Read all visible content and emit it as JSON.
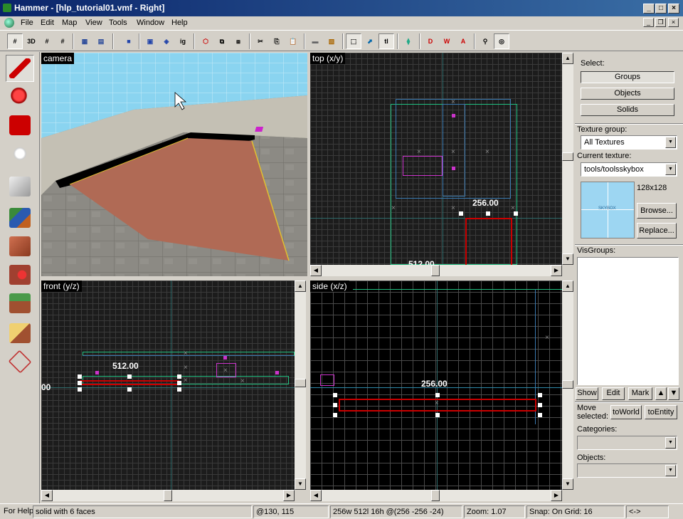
{
  "window": {
    "title": "Hammer - [hlp_tutorial01.vmf - Right]"
  },
  "menu": [
    "File",
    "Edit",
    "Map",
    "View",
    "Tools",
    "Window",
    "Help"
  ],
  "toolbar": {
    "texture_lock_label": "tl"
  },
  "views": {
    "camera": {
      "label": "camera"
    },
    "top": {
      "label": "top (x/y)",
      "dims": [
        "256.00",
        "512.00"
      ]
    },
    "front": {
      "label": "front (y/z)",
      "dims": [
        "512.00",
        "00"
      ]
    },
    "side": {
      "label": "side (x/z)",
      "dims": [
        "256.00"
      ]
    }
  },
  "right_panel": {
    "select_label": "Select:",
    "select_buttons": [
      "Groups",
      "Objects",
      "Solids"
    ],
    "texture_group_label": "Texture group:",
    "texture_group_value": "All Textures",
    "current_texture_label": "Current texture:",
    "current_texture_value": "tools/toolsskybox",
    "texture_size": "128x128",
    "texture_preview_text": "SKYBOX",
    "browse_label": "Browse...",
    "replace_label": "Replace...",
    "visgroups_label": "VisGroups:",
    "visgroup_buttons": [
      "Show",
      "Edit",
      "Mark"
    ],
    "move_selected_label": "Move selected:",
    "to_world_label": "toWorld",
    "to_entity_label": "toEntity",
    "categories_label": "Categories:",
    "objects_label": "Objects:"
  },
  "status": {
    "help": "For Help",
    "selection": "solid with 6 faces",
    "cursor": "@130, 115",
    "size": "256w 512l 16h @(256 -256 -24)",
    "zoom": "Zoom: 1.07",
    "snap": "Snap: On Grid: 16",
    "nav": "<->"
  },
  "colors": {
    "titlebar": "#0a246a",
    "selection": "#cc0000",
    "brush": "#00ffaa",
    "entity": "#cc33cc"
  },
  "icons": [
    "selection-tool-icon",
    "magnify-icon",
    "camera-tool-icon",
    "entity-tool-icon",
    "block-tool-icon",
    "texture-application-icon",
    "apply-decal-icon",
    "overlay-icon",
    "clipping-tool-icon",
    "vertex-tool-icon",
    "path-tool-icon"
  ]
}
